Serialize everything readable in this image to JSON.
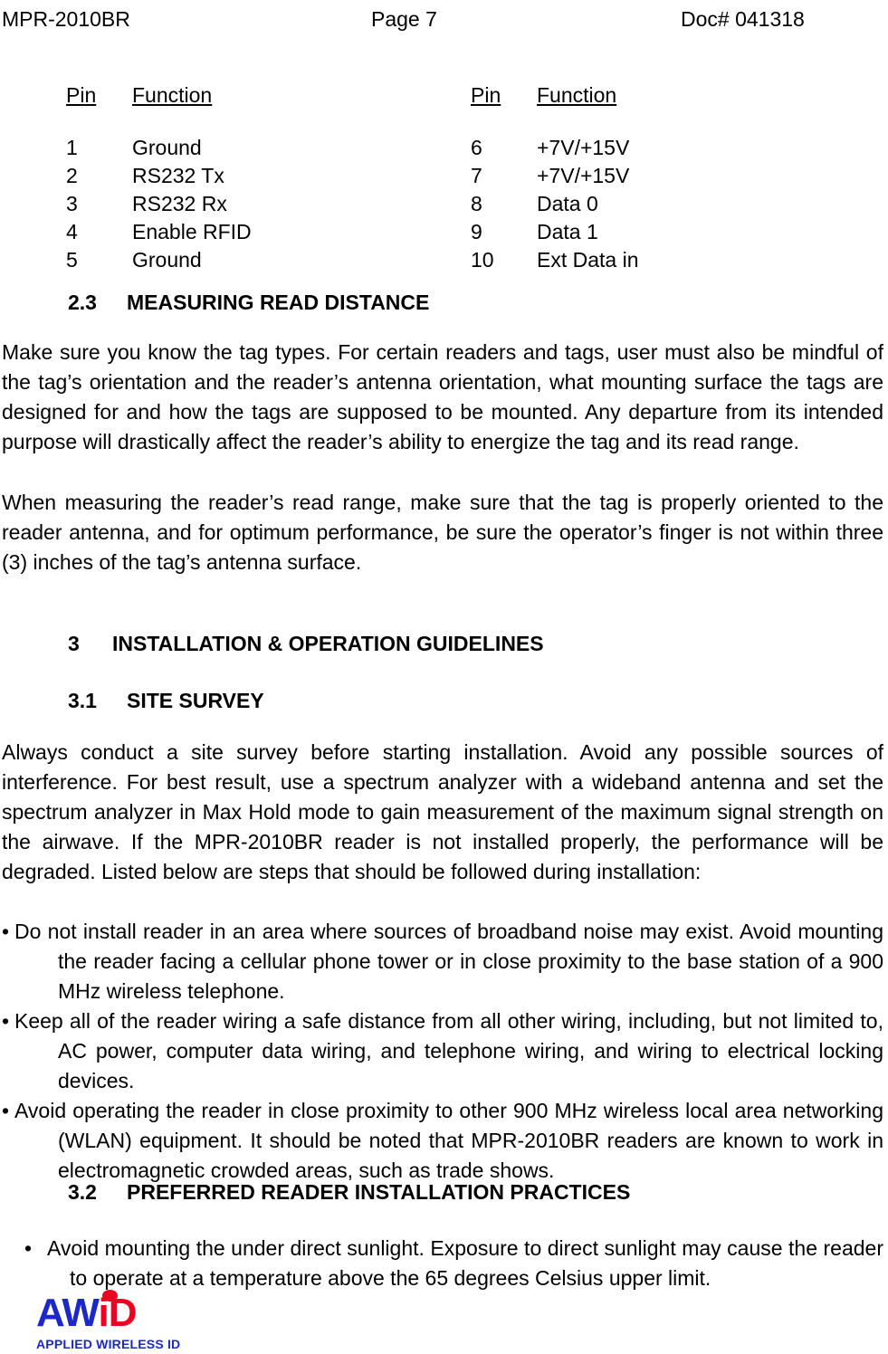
{
  "header": {
    "left": "MPR-2010BR",
    "center": "Page 7",
    "right": "Doc# 041318"
  },
  "pin_table": {
    "left": {
      "head_pin": "Pin",
      "head_function": "Function",
      "rows": [
        {
          "pin": "1",
          "function": "Ground"
        },
        {
          "pin": "2",
          "function": "RS232 Tx"
        },
        {
          "pin": "3",
          "function": "RS232 Rx"
        },
        {
          "pin": "4",
          "function": "Enable RFID"
        },
        {
          "pin": "5",
          "function": "Ground"
        }
      ]
    },
    "right": {
      "head_pin": "Pin",
      "head_function": "Function",
      "rows": [
        {
          "pin": "6",
          "function": "+7V/+15V"
        },
        {
          "pin": "7",
          "function": "+7V/+15V"
        },
        {
          "pin": "8",
          "function": "Data 0"
        },
        {
          "pin": "9",
          "function": "Data 1"
        },
        {
          "pin": "10",
          "function": "Ext Data in"
        }
      ]
    }
  },
  "sections": {
    "s2_3": {
      "number": "2.3",
      "title": "MEASURING READ DISTANCE",
      "p1": "Make sure you know the tag types. For certain readers and tags, user must also be mindful of the tag’s orientation and the reader’s antenna orientation, what mounting surface the tags are designed for and how the tags are supposed to be mounted. Any departure from its intended purpose will drastically affect the reader’s ability to energize the tag and its read range.",
      "p2": "When measuring the reader’s read range, make sure that the tag is properly oriented to the reader antenna, and for optimum performance, be sure the operator’s finger is not within three (3) inches of the tag’s antenna surface."
    },
    "s3": {
      "number": "3",
      "title": "INSTALLATION & OPERATION GUIDELINES"
    },
    "s3_1": {
      "number": "3.1",
      "title": "SITE SURVEY",
      "p1": "Always conduct a site survey before starting installation. Avoid any possible sources of interference.  For best result, use a spectrum analyzer with a wideband antenna and set the spectrum analyzer in Max Hold mode to gain measurement of the maximum signal strength on the airwave. If the MPR-2010BR reader is not installed properly, the performance will be degraded.  Listed below are steps that should be followed during installation:",
      "bullets": [
        "Do not install reader in an area where sources of broadband noise may exist. Avoid mounting the reader facing a cellular phone tower or in close proximity to the base station of a 900 MHz wireless telephone.",
        "Keep all of the reader wiring a safe distance from all other wiring, including, but not limited to, AC power, computer data wiring, and telephone wiring, and wiring to electrical locking devices.",
        "Avoid operating the reader in close proximity to other 900 MHz wireless local area networking (WLAN) equipment. It should be noted that MPR-2010BR readers are known to work in electromagnetic crowded areas, such as trade shows."
      ]
    },
    "s3_2": {
      "number": "3.2",
      "title": "PREFERRED READER INSTALLATION PRACTICES",
      "bullets": [
        "Avoid mounting the under direct sunlight.  Exposure to direct sunlight may cause the reader to operate at a temperature above the 65 degrees Celsius upper limit."
      ]
    }
  },
  "bullet_glyph": "•",
  "logo": {
    "part_aw": "AW",
    "part_i": "i",
    "part_d": "D",
    "tagline": "APPLIED WIRELESS ID",
    "blue": "#1d28c8",
    "red": "#ee0022"
  }
}
